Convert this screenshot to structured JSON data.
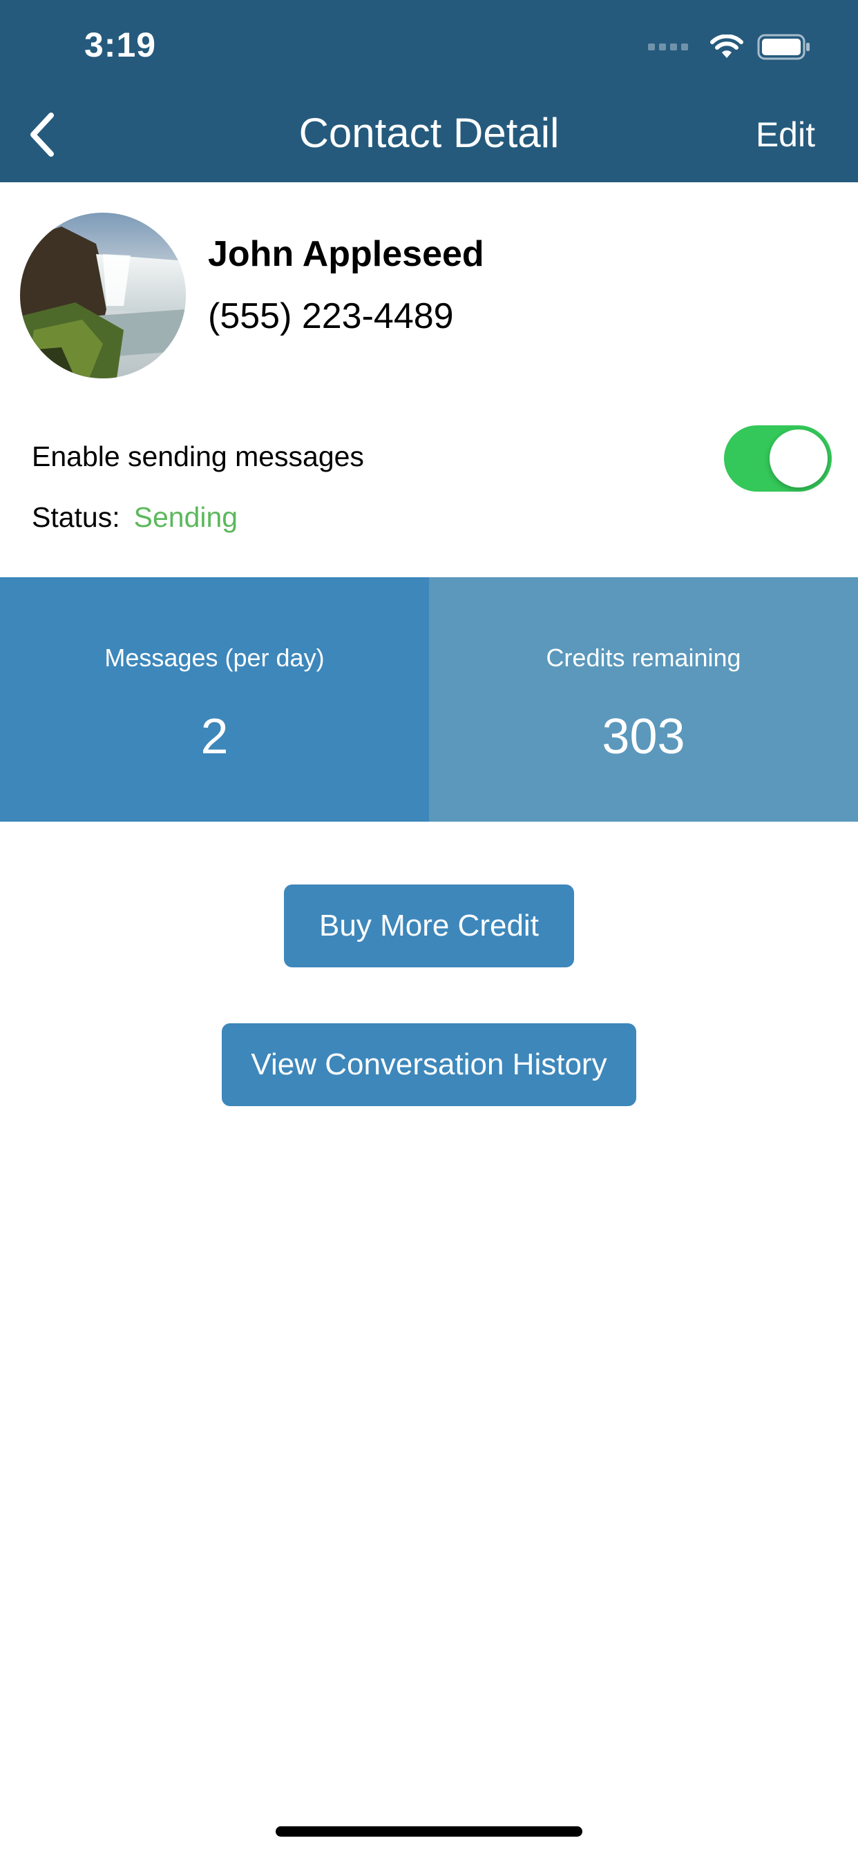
{
  "status_bar": {
    "time": "3:19",
    "icons": [
      "cellular-signal-icon",
      "wifi-icon",
      "battery-icon"
    ]
  },
  "nav": {
    "back_icon": "chevron-left-icon",
    "title": "Contact Detail",
    "edit_label": "Edit"
  },
  "contact": {
    "avatar_icon": "waterfall-photo",
    "name": "John Appleseed",
    "phone": "(555) 223-4489"
  },
  "messaging": {
    "toggle_label": "Enable sending messages",
    "enabled": true,
    "status_label": "Status:",
    "status_value": "Sending"
  },
  "stats": [
    {
      "label": "Messages (per day)",
      "value": "2"
    },
    {
      "label": "Credits remaining",
      "value": "303"
    }
  ],
  "actions": {
    "buy_label": "Buy More Credit",
    "history_label": "View Conversation History"
  },
  "colors": {
    "header": "#255a7d",
    "accent": "#3d87bb",
    "accent_light": "#5b98bc",
    "toggle_on": "#34c759",
    "status_green": "#5cb85c"
  }
}
